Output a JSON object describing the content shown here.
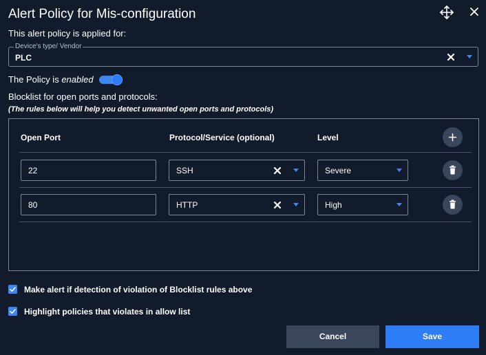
{
  "dialog": {
    "title": "Alert Policy for Mis-configuration"
  },
  "applied_for": {
    "label": "This alert policy is applied for:",
    "device_field_label": "Device's type/ Vendor",
    "device_value": "PLC"
  },
  "policy": {
    "prefix": "The Policy is",
    "state": "enabled",
    "enabled": true
  },
  "blocklist": {
    "title": "Blocklist for open ports and protocols:",
    "note": "(The rules below will help you detect unwanted open ports and protocols)",
    "columns": {
      "port": "Open Port",
      "protocol": "Protocol/Service (optional)",
      "level": "Level"
    },
    "rows": [
      {
        "port": "22",
        "protocol": "SSH",
        "level": "Severe"
      },
      {
        "port": "80",
        "protocol": "HTTP",
        "level": "High"
      }
    ]
  },
  "options": {
    "alert_violation": {
      "label": "Make alert if detection of violation of Blocklist rules above",
      "checked": true
    },
    "highlight_allow": {
      "label": "Highlight policies that violates in allow list",
      "checked": true
    }
  },
  "actions": {
    "cancel": "Cancel",
    "save": "Save"
  },
  "colors": {
    "background": "#111b2b",
    "accent": "#2e7cf6",
    "secondary_button": "#3a4659",
    "border": "#7d8797"
  },
  "icons": [
    "move-icon",
    "close-icon",
    "clear-icon",
    "chevron-down-icon",
    "plus-icon",
    "trash-icon",
    "checkmark-icon"
  ]
}
